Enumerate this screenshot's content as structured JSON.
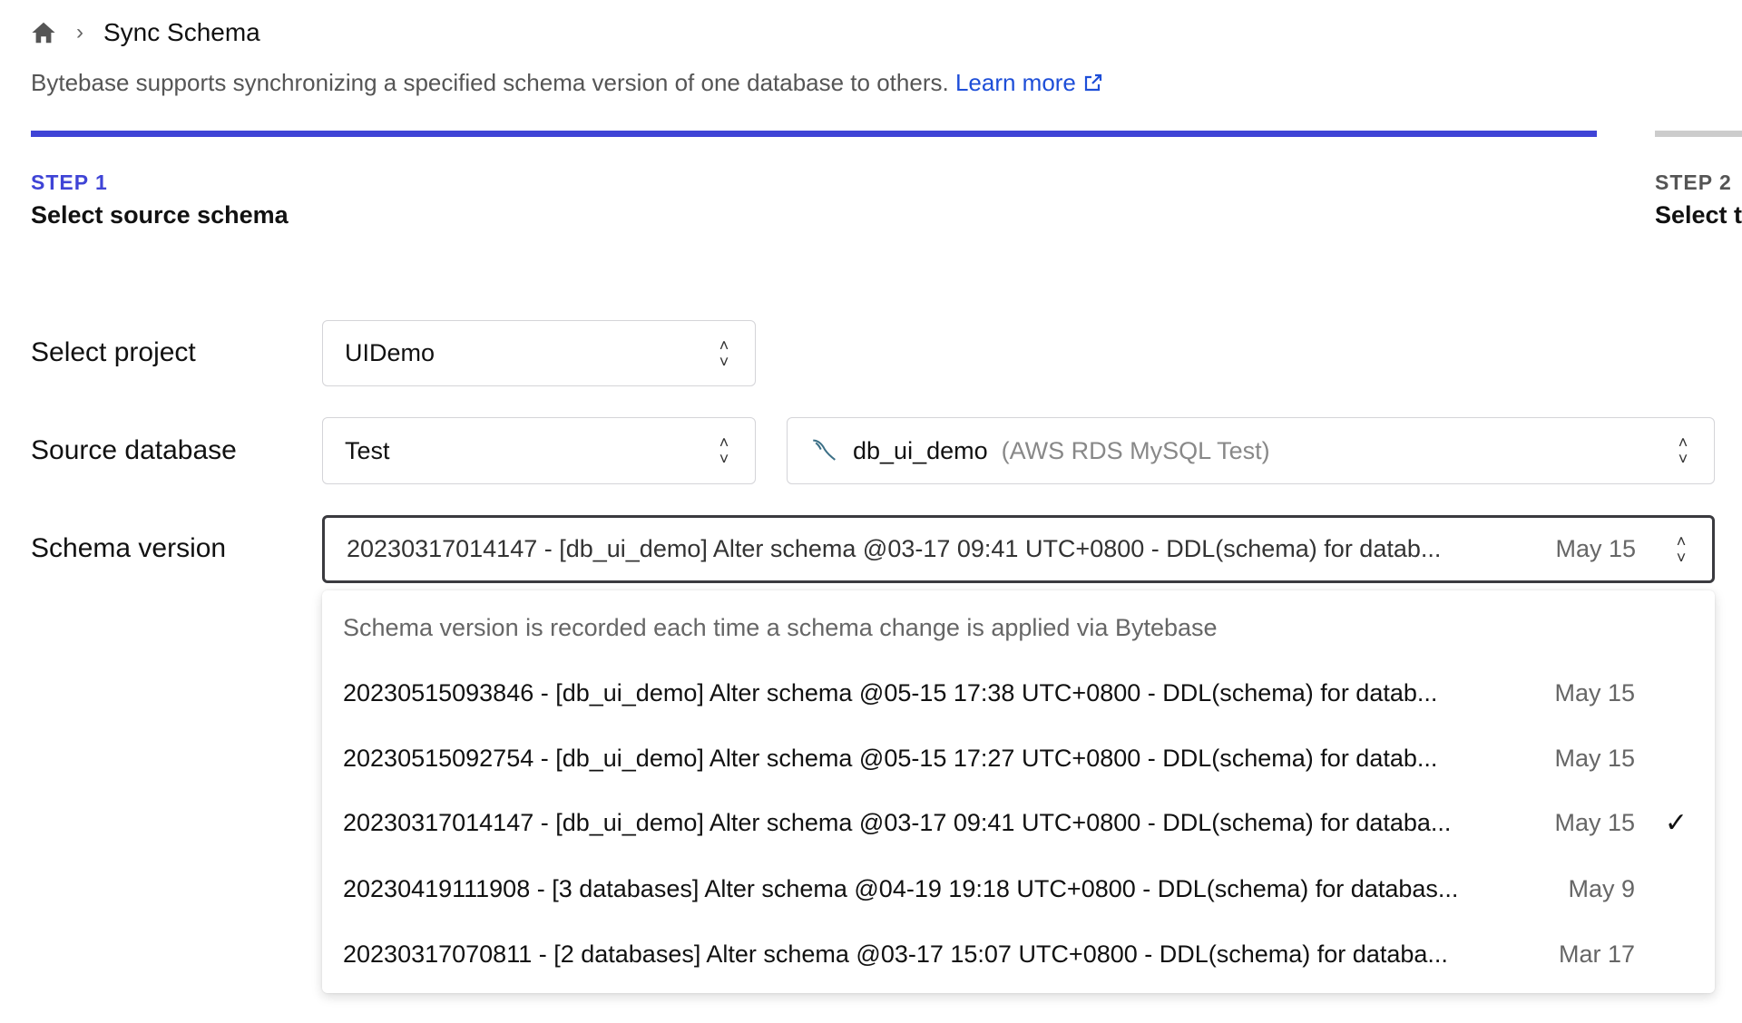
{
  "breadcrumb": {
    "home_icon": "home-icon",
    "separator_icon": "chevron-right-icon",
    "current": "Sync Schema"
  },
  "description": {
    "text": "Bytebase supports synchronizing a specified schema version of one database to others.",
    "link": "Learn more"
  },
  "steps": [
    {
      "step": "STEP 1",
      "title": "Select source schema",
      "active": true,
      "color": "#3f44d6"
    },
    {
      "step": "STEP 2",
      "title": "Select t",
      "active": false
    }
  ],
  "form": {
    "project": {
      "label": "Select project",
      "value": "UIDemo"
    },
    "source_database": {
      "label": "Source database",
      "environment": "Test",
      "database": "db_ui_demo",
      "instance": "(AWS RDS MySQL Test)",
      "icon": "mysql-icon"
    },
    "schema_version": {
      "label": "Schema version",
      "value": "20230317014147 - [db_ui_demo] Alter schema @03-17 09:41 UTC+0800 - DDL(schema) for datab...",
      "date": "May 15"
    }
  },
  "dropdown": {
    "hint": "Schema version is recorded each time a schema change is applied via Bytebase",
    "items": [
      {
        "text": "20230515093846 - [db_ui_demo] Alter schema @05-15 17:38 UTC+0800 - DDL(schema) for datab...",
        "date": "May 15",
        "selected": false
      },
      {
        "text": "20230515092754 - [db_ui_demo] Alter schema @05-15 17:27 UTC+0800 - DDL(schema) for datab...",
        "date": "May 15",
        "selected": false
      },
      {
        "text": "20230317014147 - [db_ui_demo] Alter schema @03-17 09:41 UTC+0800 - DDL(schema) for databa...",
        "date": "May 15",
        "selected": true
      },
      {
        "text": "20230419111908 - [3 databases] Alter schema @04-19 19:18 UTC+0800 - DDL(schema) for databas...",
        "date": "May 9",
        "selected": false
      },
      {
        "text": "20230317070811 - [2 databases] Alter schema @03-17 15:07 UTC+0800 - DDL(schema) for databa...",
        "date": "Mar 17",
        "selected": false
      }
    ]
  }
}
